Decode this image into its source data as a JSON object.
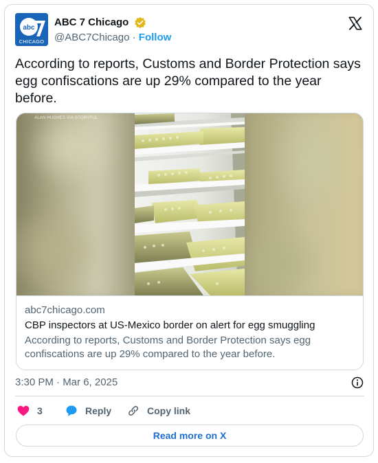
{
  "author": {
    "name": "ABC 7 Chicago",
    "handle": "@ABC7Chicago",
    "separator": "·",
    "follow_label": "Follow",
    "avatar_text": "CHICAGO"
  },
  "tweet": {
    "text": "According to reports, Customs and Border Protection says egg confiscations are up 29% compared to the year before."
  },
  "link_card": {
    "watermark": "ALAN HUGHES VIA STORYFUL",
    "domain": "abc7chicago.com",
    "title": "CBP inspectors at US-Mexico border on alert for egg smuggling",
    "description": "According to reports, Customs and Border Protection says egg confiscations are up 29% compared to the year before."
  },
  "meta": {
    "timestamp": "3:30 PM · Mar 6, 2025"
  },
  "actions": {
    "like_count": "3",
    "reply_label": "Reply",
    "copy_link_label": "Copy link"
  },
  "read_more_label": "Read more on X",
  "colors": {
    "accent": "#1d9bf0",
    "like": "#f91880",
    "verified": "#e2b719",
    "avatar": "#1a64b8",
    "muted": "#536471",
    "border": "#cfd9de"
  }
}
